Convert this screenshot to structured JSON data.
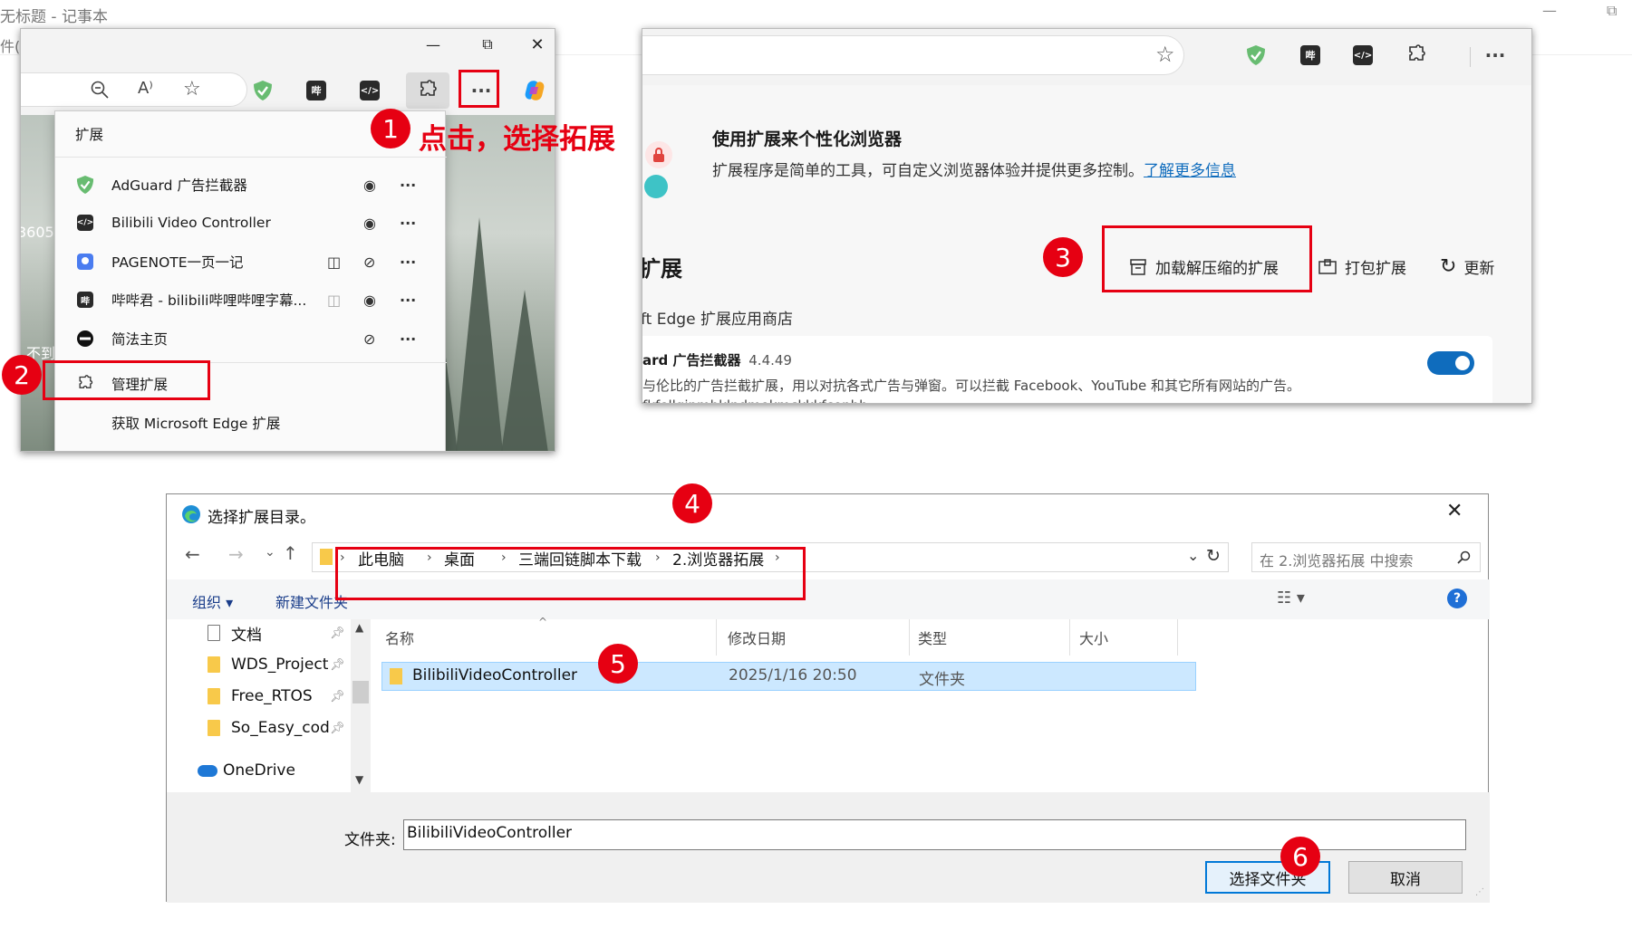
{
  "notepad": {
    "title": "无标题 - 记事本",
    "menu_fragment": "件(F"
  },
  "panel1": {
    "window_controls": {
      "minimize": "—",
      "restore": "⧉",
      "close": "✕"
    },
    "menu": {
      "header": "扩展",
      "items": [
        {
          "label": "AdGuard 广告拦截器",
          "icon": "adguard-shield-icon"
        },
        {
          "label": "Bilibili Video Controller",
          "icon": "code-box-icon"
        },
        {
          "label": "PAGENOTE一页一记",
          "icon": "pin-icon"
        },
        {
          "label": "哔哔君 - bilibili哔哩哔哩字幕...",
          "icon": "bi-icon",
          "icon_text": "哔"
        },
        {
          "label": "简法主页",
          "icon": "jianfa-icon"
        }
      ],
      "manage": "管理扩展",
      "get_more": "获取 Microsoft Edge 扩展"
    },
    "more_dots": "···",
    "bg_text_1": "3605",
    "bg_text_2": "不到"
  },
  "panel2": {
    "heading": "使用扩展来个性化浏览器",
    "desc": "扩展程序是简单的工具，可自定义浏览器体验并提供更多控制。",
    "learn_more": "了解更多信息",
    "section_title": "扩展",
    "load_unpacked": "加载解压缩的扩展",
    "pack": "打包扩展",
    "update": "更新",
    "store_label": "ft Edge 扩展应用商店",
    "ext_name": "ard 广告拦截器",
    "ext_version": "4.4.49",
    "ext_desc": "与伦比的广告拦截扩展，用以对抗各式广告与弹窗。可以拦截 Facebook、YouTube 和其它所有网站的广告。",
    "ext_id": "fkfellginmhklndmokmckkkfconbh",
    "toolbar_bi": "哔",
    "toggle_on": true
  },
  "annotations": {
    "step1": "1",
    "step1_text": "点击，选择拓展",
    "step2": "2",
    "step3": "3",
    "step4": "4",
    "step5": "5",
    "step6": "6",
    "accent": "#e60012"
  },
  "dialog": {
    "title": "选择扩展目录。",
    "breadcrumb": [
      "此电脑",
      "桌面",
      "三端回链脚本下载",
      "2.浏览器拓展"
    ],
    "search_placeholder": "在 2.浏览器拓展 中搜索",
    "organize": "组织 ▾",
    "new_folder": "新建文件夹",
    "sidebar": [
      {
        "label": "文档",
        "icon": "document-icon",
        "pinned": true
      },
      {
        "label": "WDS_Project",
        "icon": "folder-icon",
        "pinned": true
      },
      {
        "label": "Free_RTOS",
        "icon": "folder-icon",
        "pinned": true
      },
      {
        "label": "So_Easy_cod",
        "icon": "folder-icon",
        "pinned": true
      },
      {
        "label": "OneDrive",
        "icon": "cloud-icon",
        "pinned": false
      }
    ],
    "columns": [
      "名称",
      "修改日期",
      "类型",
      "大小"
    ],
    "rows": [
      {
        "name": "BilibiliVideoController",
        "date": "2025/1/16 20:50",
        "type": "文件夹",
        "size": ""
      }
    ],
    "folder_label": "文件夹:",
    "folder_value": "BilibiliVideoController",
    "select_button": "选择文件夹",
    "cancel_button": "取消"
  }
}
